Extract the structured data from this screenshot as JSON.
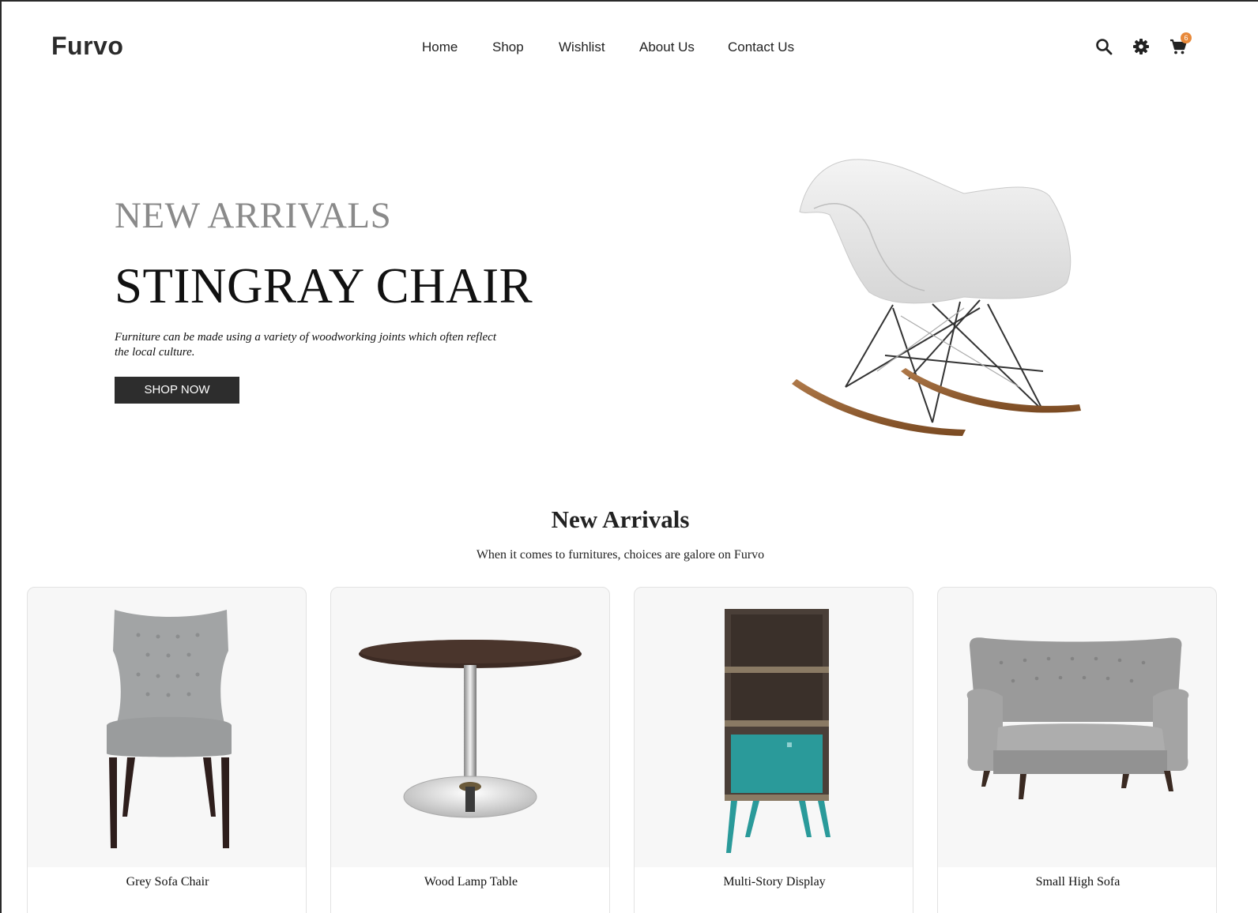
{
  "brand": {
    "logo": "Furvo"
  },
  "nav": {
    "items": [
      {
        "label": "Home"
      },
      {
        "label": "Shop"
      },
      {
        "label": "Wishlist"
      },
      {
        "label": "About Us"
      },
      {
        "label": "Contact Us"
      }
    ]
  },
  "header_icons": {
    "search": "search-icon",
    "settings": "gear-icon",
    "cart": "cart-icon",
    "cart_count": "6",
    "badge_color": "#e8893a"
  },
  "hero": {
    "kicker": "NEW ARRIVALS",
    "title": "STINGRAY CHAIR",
    "description": "Furniture can be made using a variety of woodworking joints which often reflect the local culture.",
    "button_label": "SHOP NOW"
  },
  "new_arrivals": {
    "title": "New Arrivals",
    "subtitle": "When it comes to furnitures, choices are galore on Furvo",
    "products": [
      {
        "name": "Grey Sofa Chair"
      },
      {
        "name": "Wood Lamp Table"
      },
      {
        "name": "Multi-Story Display"
      },
      {
        "name": "Small High Sofa"
      }
    ]
  },
  "colors": {
    "button_bg": "#2d2d2d",
    "kicker_text": "#8a8a8a",
    "card_bg": "#f7f7f7",
    "cabinet_accent": "#2a9a9a"
  }
}
